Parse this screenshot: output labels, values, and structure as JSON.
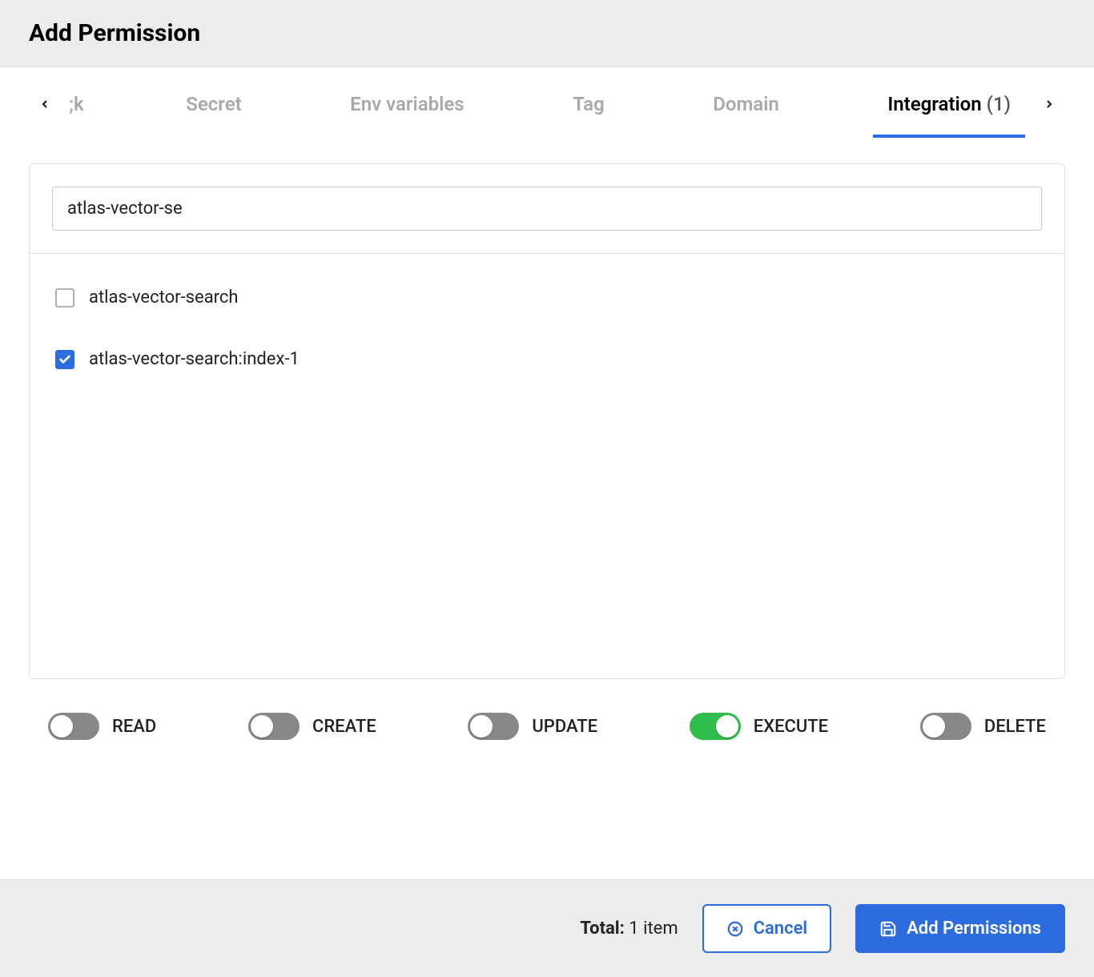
{
  "header": {
    "title": "Add Permission"
  },
  "tabs": {
    "partial_left": ";k",
    "items": [
      {
        "label": "Secret"
      },
      {
        "label": "Env variables"
      },
      {
        "label": "Tag"
      },
      {
        "label": "Domain"
      }
    ],
    "active": {
      "label": "Integration",
      "count": "(1)"
    }
  },
  "search": {
    "value": "atlas-vector-se"
  },
  "results": [
    {
      "label": "atlas-vector-search",
      "checked": false
    },
    {
      "label": "atlas-vector-search:index-1",
      "checked": true
    }
  ],
  "permissions": [
    {
      "label": "READ",
      "on": false
    },
    {
      "label": "CREATE",
      "on": false
    },
    {
      "label": "UPDATE",
      "on": false
    },
    {
      "label": "EXECUTE",
      "on": true
    },
    {
      "label": "DELETE",
      "on": false
    }
  ],
  "footer": {
    "total_label": "Total:",
    "total_value": "1 item",
    "cancel": "Cancel",
    "add": "Add Permissions"
  }
}
